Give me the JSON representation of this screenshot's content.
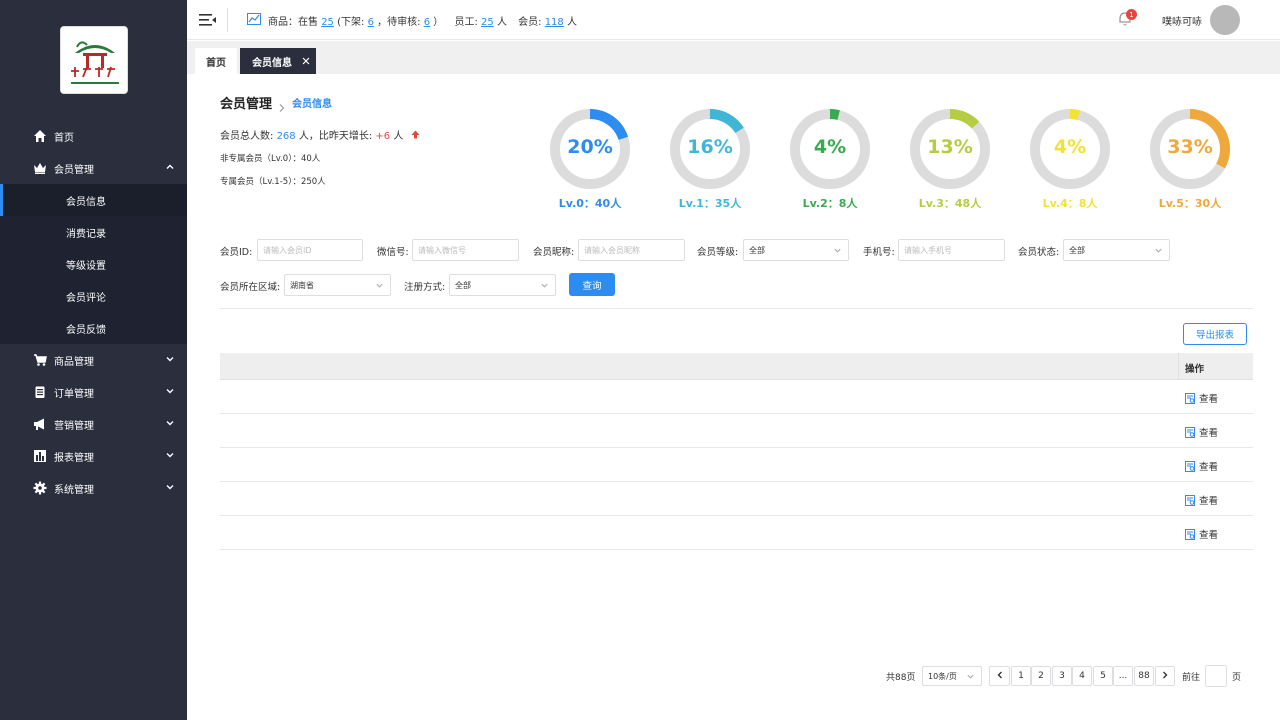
{
  "header": {
    "goods_label": "商品：在售",
    "on_sale": "25",
    "off_label": "(下架:",
    "off_count": "6",
    "pending_label": "，待审核:",
    "pending_count": "6",
    "close_paren": "）",
    "staff_label": "员工:",
    "staff_count": "25",
    "staff_unit": "人",
    "member_label": "会员:",
    "member_count": "118",
    "member_unit": "人",
    "notification_count": "1",
    "username": "噗哧可哧"
  },
  "sidebar": {
    "items": [
      {
        "label": "首页",
        "icon": "home-icon"
      },
      {
        "label": "会员管理",
        "icon": "crown-icon"
      },
      {
        "label": "商品管理",
        "icon": "cart-icon"
      },
      {
        "label": "订单管理",
        "icon": "clipboard-icon"
      },
      {
        "label": "营销管理",
        "icon": "megaphone-icon"
      },
      {
        "label": "报表管理",
        "icon": "bar-chart-icon"
      },
      {
        "label": "系统管理",
        "icon": "gear-icon"
      }
    ],
    "sub_items": [
      "会员信息",
      "消费记录",
      "等级设置",
      "会员评论",
      "会员反馈"
    ]
  },
  "tabs": {
    "home": "首页",
    "member_info": "会员信息"
  },
  "breadcrumb": {
    "title": "会员管理",
    "current": "会员信息"
  },
  "stats": {
    "total_label": "会员总人数:",
    "total": "268",
    "total_unit": "人，比昨天增长:",
    "growth": "+6",
    "growth_unit": "人",
    "non_exclusive": "非专属会员（Lv.0）：40人",
    "exclusive": "专属会员（Lv.1-5）：250人"
  },
  "levels": [
    {
      "percent": "20%",
      "value": 20,
      "label": "Lv.0：40人",
      "color": "#2d8cf0"
    },
    {
      "percent": "16%",
      "value": 16,
      "label": "Lv.1：35人",
      "color": "#3fb6d6"
    },
    {
      "percent": "4%",
      "value": 4,
      "label": "Lv.2：8人",
      "color": "#3aaa52"
    },
    {
      "percent": "13%",
      "value": 13,
      "label": "Lv.3：48人",
      "color": "#b5cc43"
    },
    {
      "percent": "4%",
      "value": 4,
      "label": "Lv.4：8人",
      "color": "#f2e234"
    },
    {
      "percent": "33%",
      "value": 33,
      "label": "Lv.5：30人",
      "color": "#efa83c"
    }
  ],
  "filters": {
    "id_label": "会员ID:",
    "id_placeholder": "请输入会员ID",
    "wechat_label": "微信号:",
    "wechat_placeholder": "请输入微信号",
    "nick_label": "会员昵称:",
    "nick_placeholder": "请输入会员昵称",
    "level_label": "会员等级:",
    "level_value": "全部",
    "phone_label": "手机号:",
    "phone_placeholder": "请输入手机号",
    "status_label": "会员状态:",
    "status_value": "全部",
    "region_label": "会员所在区域:",
    "region_value": "湖南省",
    "reg_label": "注册方式:",
    "reg_value": "全部",
    "query_button": "查询"
  },
  "table": {
    "export_button": "导出报表",
    "action_header": "操作",
    "view_label": "查看",
    "row_count": 5
  },
  "pagination": {
    "total": "共88页",
    "page_size": "10条/页",
    "pages": [
      "1",
      "2",
      "3",
      "4",
      "5",
      "...",
      "88"
    ],
    "goto_label": "前往",
    "goto_unit": "页"
  },
  "colors": {
    "sidebar": "#2b2e3c",
    "accent": "#2d8cf0",
    "growth": "#e8453c"
  }
}
